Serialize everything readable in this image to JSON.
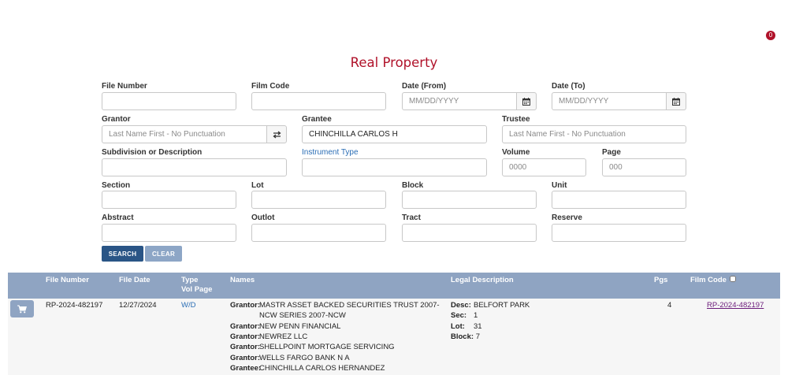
{
  "header": {
    "cart_count": "0",
    "title": "Real Property"
  },
  "form": {
    "file_number": {
      "label": "File Number",
      "value": "",
      "placeholder": ""
    },
    "film_code": {
      "label": "Film Code",
      "value": "",
      "placeholder": ""
    },
    "date_from": {
      "label": "Date (From)",
      "placeholder": "MM/DD/YYYY"
    },
    "date_to": {
      "label": "Date (To)",
      "placeholder": "MM/DD/YYYY"
    },
    "grantor": {
      "label": "Grantor",
      "placeholder": "Last Name First - No Punctuation"
    },
    "grantee": {
      "label": "Grantee",
      "value": "CHINCHILLA CARLOS H"
    },
    "trustee": {
      "label": "Trustee",
      "placeholder": "Last Name First - No Punctuation"
    },
    "subdivision": {
      "label": "Subdivision or Description"
    },
    "instrument_type": {
      "label": "Instrument Type"
    },
    "volume": {
      "label": "Volume",
      "placeholder": "0000"
    },
    "page": {
      "label": "Page",
      "placeholder": "000"
    },
    "section": {
      "label": "Section"
    },
    "lot": {
      "label": "Lot"
    },
    "block": {
      "label": "Block"
    },
    "unit": {
      "label": "Unit"
    },
    "abstract": {
      "label": "Abstract"
    },
    "outlot": {
      "label": "Outlot"
    },
    "tract": {
      "label": "Tract"
    },
    "reserve": {
      "label": "Reserve"
    },
    "search_label": "SEARCH",
    "clear_label": "CLEAR"
  },
  "results": {
    "columns": {
      "file_number": "File Number",
      "file_date": "File Date",
      "type": "Type",
      "vol_page": "Vol Page",
      "names": "Names",
      "legal_description": "Legal Description",
      "pgs": "Pgs",
      "film_code": "Film Code"
    },
    "rows": [
      {
        "file_number": "RP-2024-482197",
        "file_date": "12/27/2024",
        "type": "W/D",
        "names": [
          {
            "role": "Grantor:",
            "name_line1": "MASTR ASSET BACKED SECURITIES TRUST 2007-",
            "name_line2": "NCW SERIES 2007-NCW"
          },
          {
            "role": "Grantor:",
            "name": "NEW PENN FINANCIAL"
          },
          {
            "role": "Grantor:",
            "name": "NEWREZ LLC"
          },
          {
            "role": "Grantor:",
            "name": "SHELLPOINT MORTGAGE SERVICING"
          },
          {
            "role": "Grantor:",
            "name": "WELLS FARGO BANK N A"
          },
          {
            "role": "Grantee:",
            "name": "CHINCHILLA CARLOS HERNANDEZ"
          }
        ],
        "legal": {
          "desc_label": "Desc:",
          "desc": "BELFORT PARK",
          "sec_label": "Sec:",
          "sec": "1",
          "lot_label": "Lot:",
          "lot": "31",
          "block_label": "Block:",
          "block": "7"
        },
        "pgs": "4",
        "film_code": "RP-2024-482197"
      }
    ]
  },
  "colors": {
    "accent": "#b0122a",
    "header_bg": "#8fa4c2",
    "button_primary": "#2a5586",
    "button_secondary": "#8da6c6"
  },
  "icons": {
    "cart": "shopping-cart-icon",
    "calendar": "calendar-icon",
    "swap": "swap-arrows-icon"
  }
}
